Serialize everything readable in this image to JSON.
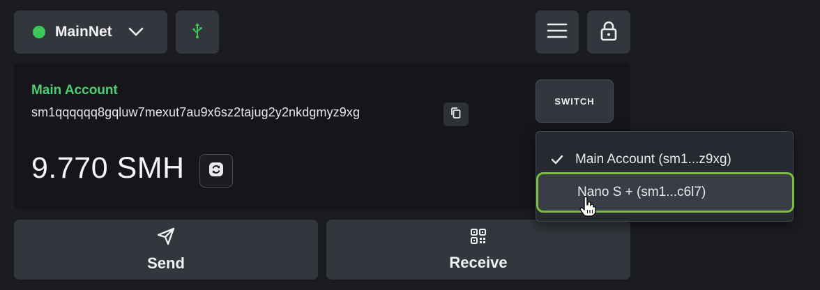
{
  "network": {
    "label": "MainNet",
    "status_color": "#3bc957"
  },
  "toolbar": {
    "usb_icon": "usb-icon",
    "menu_icon": "hamburger-menu-icon",
    "lock_icon": "lock-icon"
  },
  "account": {
    "name": "Main Account",
    "address": "sm1qqqqqq8gqluw7mexut7au9x6sz2tajug2y2nkdgmyz9xg",
    "balance": "9.770 SMH",
    "switch_label": "SWITCH"
  },
  "actions": {
    "send_label": "Send",
    "receive_label": "Receive"
  },
  "account_menu": {
    "items": [
      {
        "label": "Main Account (sm1...z9xg)",
        "selected": true
      },
      {
        "label": "Nano S + (sm1...c6l7)",
        "selected": false,
        "highlighted": true
      }
    ]
  },
  "colors": {
    "accent_green": "#4fcf73",
    "highlight_border": "#7bbd3e"
  }
}
